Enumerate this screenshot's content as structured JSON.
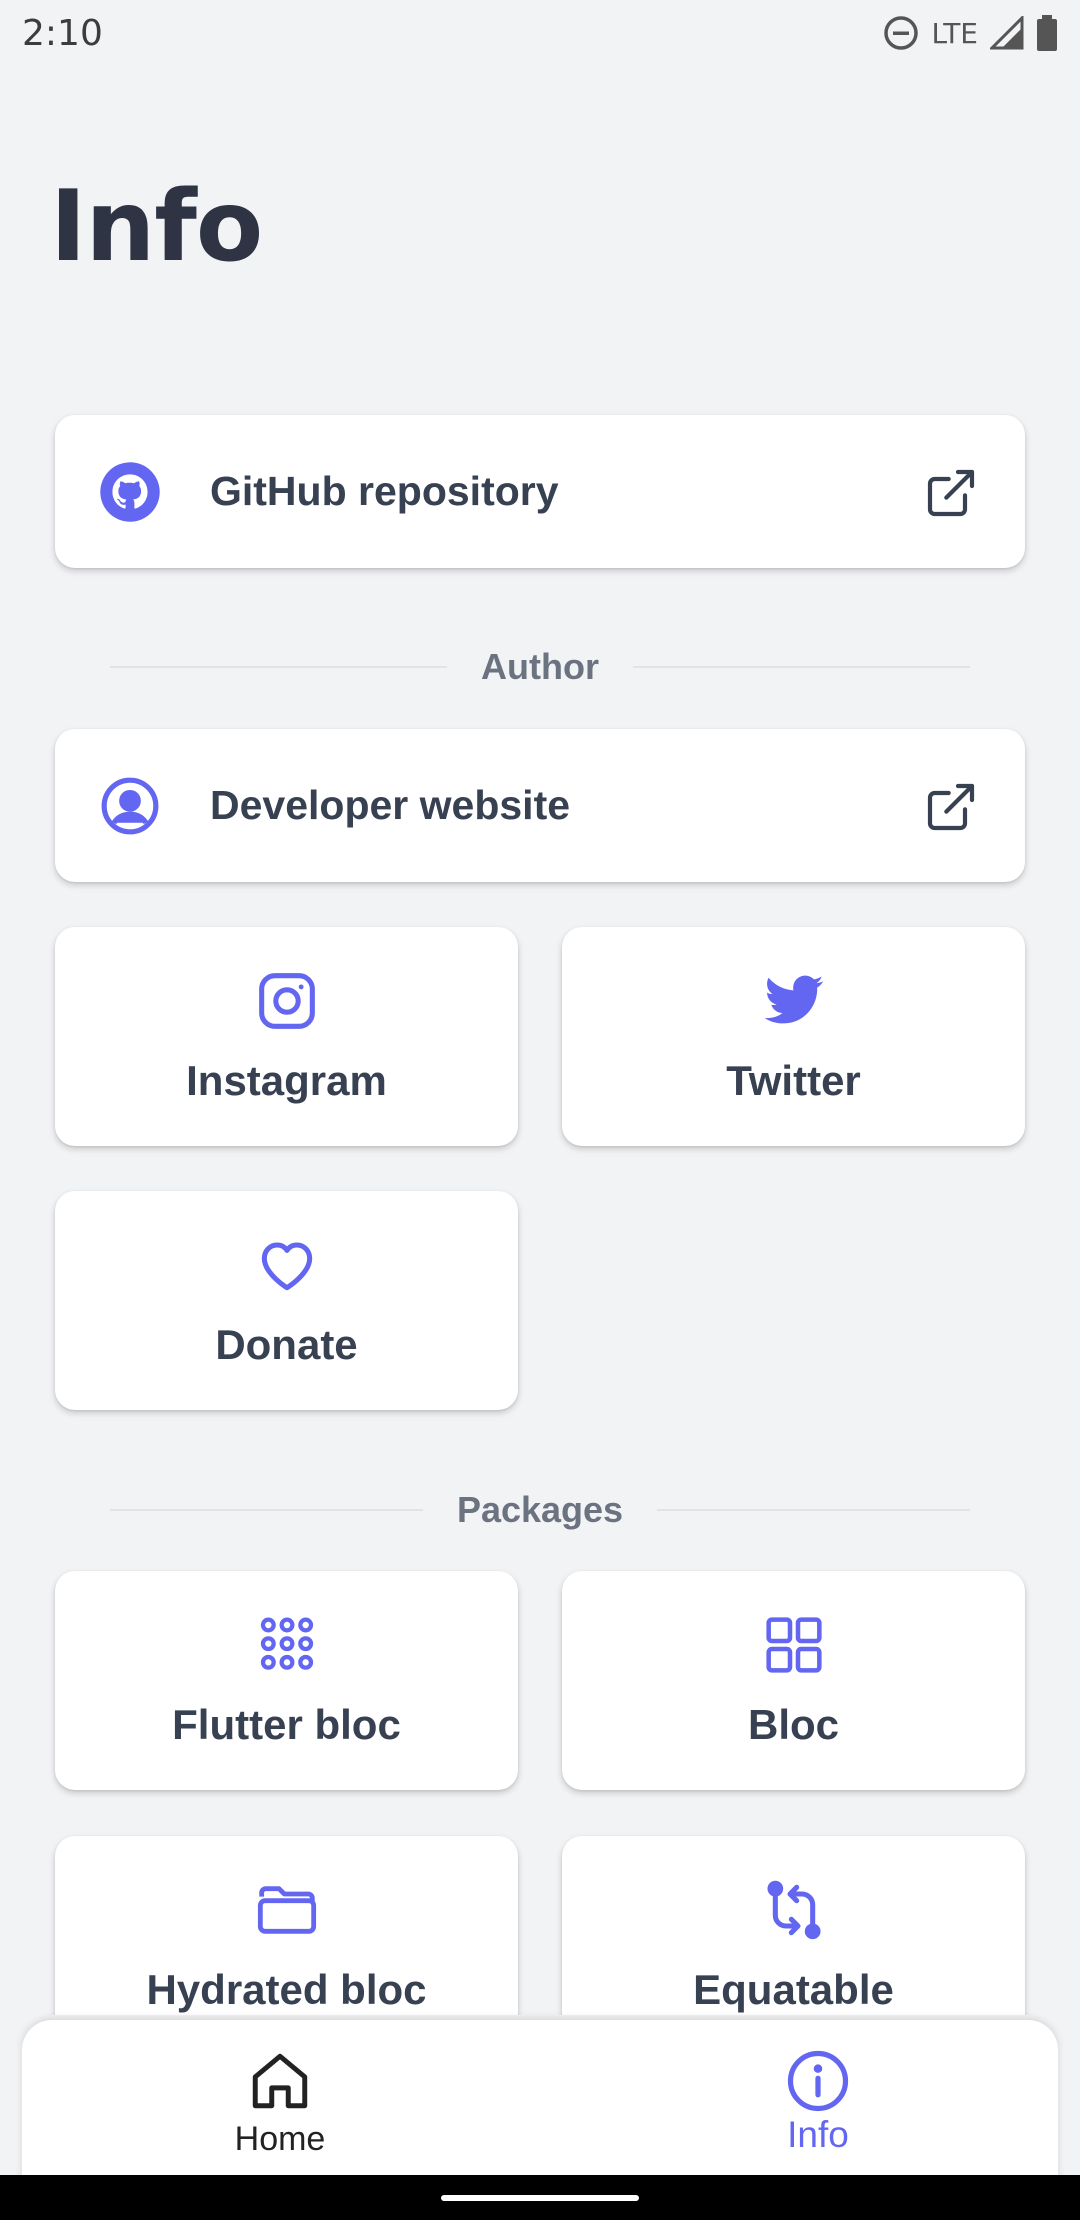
{
  "status_bar": {
    "time": "2:10",
    "network": "LTE"
  },
  "page": {
    "title": "Info"
  },
  "repo_link": {
    "label": "GitHub repository",
    "icon": "github-icon"
  },
  "author_section": {
    "heading": "Author",
    "developer_link": {
      "label": "Developer website",
      "icon": "user-circle-icon"
    },
    "tiles": [
      {
        "label": "Instagram",
        "icon": "instagram-icon"
      },
      {
        "label": "Twitter",
        "icon": "twitter-icon"
      },
      {
        "label": "Donate",
        "icon": "heart-icon"
      }
    ]
  },
  "packages_section": {
    "heading": "Packages",
    "tiles": [
      {
        "label": "Flutter bloc",
        "icon": "dots-grid-icon"
      },
      {
        "label": "Bloc",
        "icon": "grid-icon"
      },
      {
        "label": "Hydrated bloc",
        "icon": "folder-icon"
      },
      {
        "label": "Equatable",
        "icon": "compare-arrows-icon"
      }
    ]
  },
  "bottom_nav": {
    "items": [
      {
        "label": "Home",
        "icon": "home-icon",
        "active": false
      },
      {
        "label": "Info",
        "icon": "info-icon",
        "active": true
      }
    ]
  },
  "colors": {
    "accent": "#6366f1",
    "background": "#f2f3f5",
    "card": "#ffffff",
    "text": "#374151",
    "muted": "#6b7280"
  }
}
